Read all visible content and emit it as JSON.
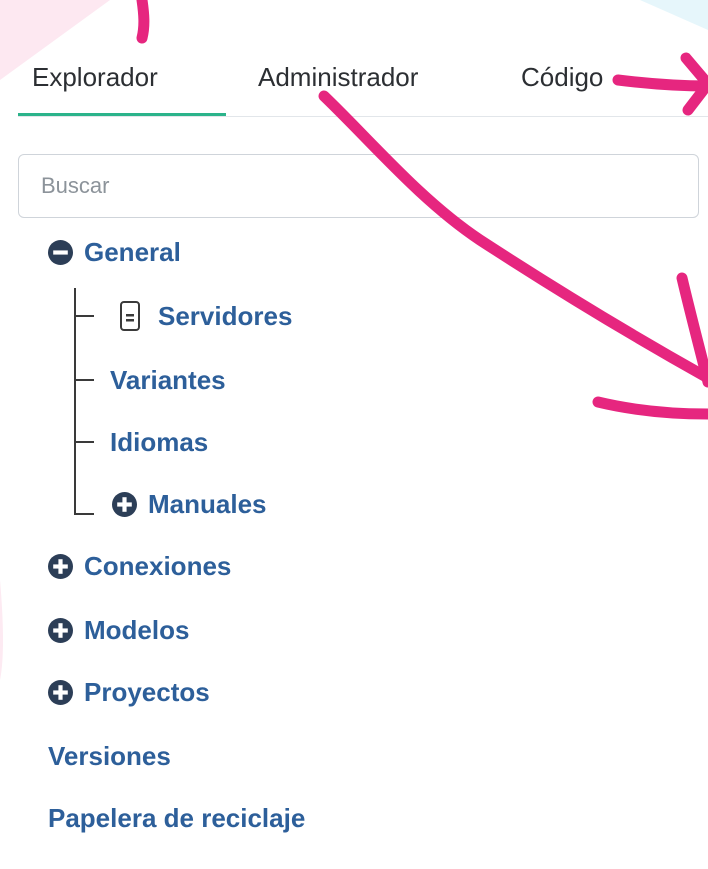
{
  "tabs": [
    {
      "label": "Explorador",
      "active": true
    },
    {
      "label": "Administrador",
      "active": false
    },
    {
      "label": "Código",
      "active": false
    }
  ],
  "search": {
    "placeholder": "Buscar",
    "value": ""
  },
  "tree": {
    "general": {
      "label": "General",
      "state": "expanded"
    },
    "children": [
      {
        "label": "Servidores",
        "icon": "server-icon"
      },
      {
        "label": "Variantes"
      },
      {
        "label": "Idiomas"
      },
      {
        "label": "Manuales",
        "state": "collapsed"
      }
    ],
    "conexiones": {
      "label": "Conexiones",
      "state": "collapsed"
    },
    "modelos": {
      "label": "Modelos",
      "state": "collapsed"
    },
    "proyectos": {
      "label": "Proyectos",
      "state": "collapsed"
    },
    "versiones": {
      "label": "Versiones"
    },
    "papelera": {
      "label": "Papelera de reciclaje"
    }
  },
  "colors": {
    "accent": "#2bb38a",
    "tree_text": "#2d5f9a",
    "annotation": "#e6267f"
  }
}
